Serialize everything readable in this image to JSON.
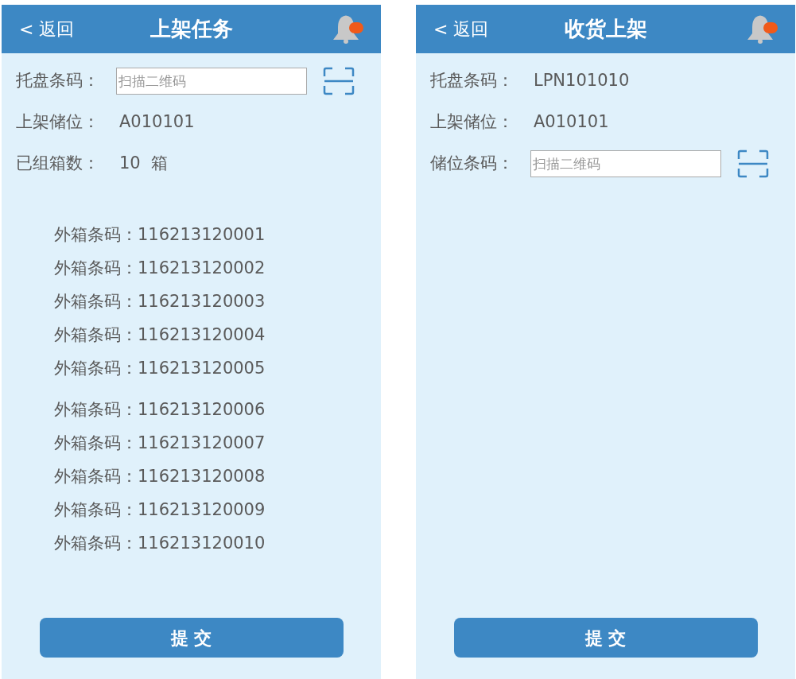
{
  "screens": [
    {
      "header": {
        "back": "< 返回",
        "title": "上架任务",
        "has_notification": true
      },
      "rows": [
        {
          "kind": "field",
          "label": "托盘条码：",
          "placeholder": "扫描二维码"
        },
        {
          "kind": "value",
          "label": "上架储位：",
          "value": "A010101"
        },
        {
          "kind": "value",
          "label": "已组箱数：",
          "value": "10  箱"
        }
      ],
      "box_groups": [
        [
          {
            "label": "外箱条码：",
            "value": "116213120001"
          },
          {
            "label": "外箱条码：",
            "value": "116213120002"
          },
          {
            "label": "外箱条码：",
            "value": "116213120003"
          },
          {
            "label": "外箱条码：",
            "value": "116213120004"
          },
          {
            "label": "外箱条码：",
            "value": "116213120005"
          }
        ],
        [
          {
            "label": "外箱条码：",
            "value": "116213120006"
          },
          {
            "label": "外箱条码：",
            "value": "116213120007"
          },
          {
            "label": "外箱条码：",
            "value": "116213120008"
          },
          {
            "label": "外箱条码：",
            "value": "116213120009"
          },
          {
            "label": "外箱条码：",
            "value": "116213120010"
          }
        ]
      ],
      "submit": "提 交"
    },
    {
      "header": {
        "back": "< 返回",
        "title": "收货上架",
        "has_notification": true
      },
      "rows": [
        {
          "kind": "value",
          "label": "托盘条码：",
          "value": "LPN101010"
        },
        {
          "kind": "value",
          "label": "上架储位：",
          "value": "A010101"
        },
        {
          "kind": "field",
          "label": "储位条码：",
          "placeholder": "扫描二维码"
        }
      ],
      "submit": "提 交"
    }
  ]
}
